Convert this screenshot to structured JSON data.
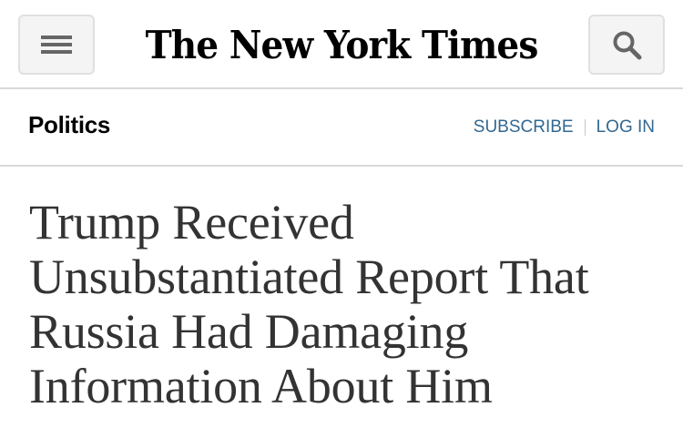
{
  "header": {
    "masthead": "The New York Times",
    "menu_icon": "hamburger-menu-icon",
    "search_icon": "search-icon"
  },
  "section_bar": {
    "section_name": "Politics",
    "subscribe_label": "SUBSCRIBE",
    "login_label": "LOG IN",
    "link_color": "#326891"
  },
  "article": {
    "headline": "Trump Received Unsubstantiated Report That Russia Had Damaging Information About Him"
  }
}
